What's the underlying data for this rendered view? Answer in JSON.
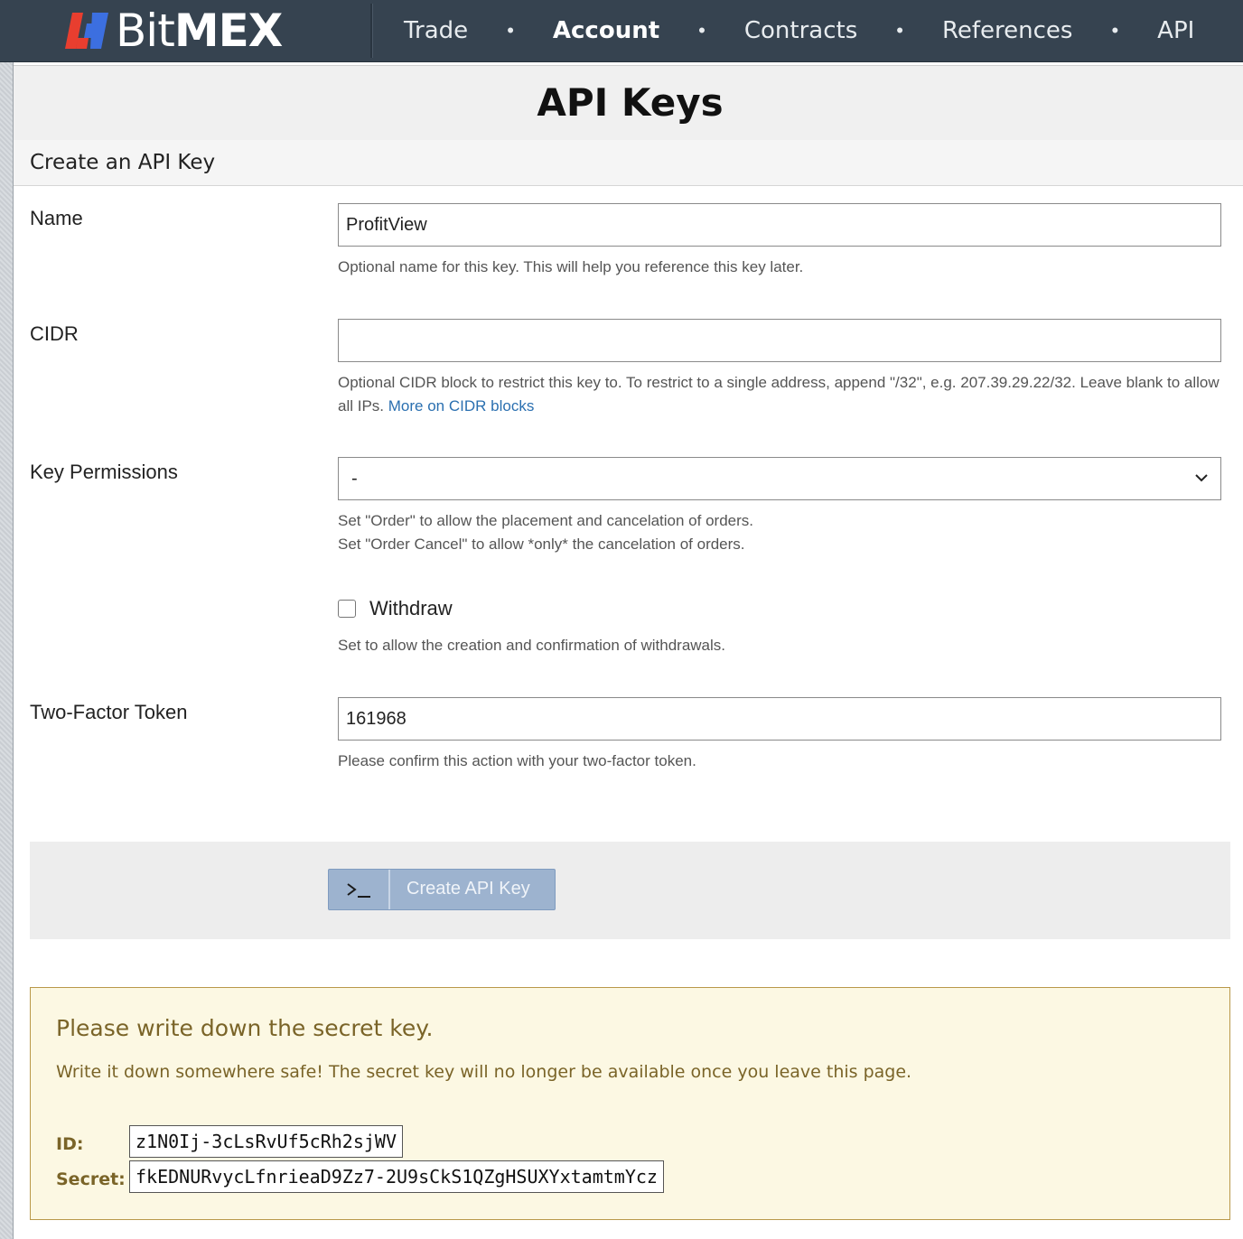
{
  "brand": {
    "logo_text_thin": "Bit",
    "logo_text_bold": "MEX",
    "colors": {
      "navbar": "#364350",
      "logo_red": "#e83e2f",
      "logo_blue": "#3c6fe0"
    }
  },
  "nav": {
    "items": [
      {
        "label": "Trade",
        "active": false
      },
      {
        "label": "Account",
        "active": true
      },
      {
        "label": "Contracts",
        "active": false
      },
      {
        "label": "References",
        "active": false
      },
      {
        "label": "API",
        "active": false
      }
    ],
    "separator": "•"
  },
  "page": {
    "title": "API Keys"
  },
  "form": {
    "section_title": "Create an API Key",
    "name": {
      "label": "Name",
      "value": "ProfitView",
      "help": "Optional name for this key. This will help you reference this key later."
    },
    "cidr": {
      "label": "CIDR",
      "value": "",
      "help": "Optional CIDR block to restrict this key to. To restrict to a single address, append \"/32\", e.g. 207.39.29.22/32. Leave blank to allow all IPs.",
      "help_link": "More on CIDR blocks"
    },
    "permissions": {
      "label": "Key Permissions",
      "selected": "-",
      "help_line1": "Set \"Order\" to allow the placement and cancelation of orders.",
      "help_line2": "Set \"Order Cancel\" to allow *only* the cancelation of orders."
    },
    "withdraw": {
      "label": "Withdraw",
      "checked": false,
      "help": "Set to allow the creation and confirmation of withdrawals."
    },
    "two_factor": {
      "label": "Two-Factor Token",
      "value": "161968",
      "help": "Please confirm this action with your two-factor token."
    },
    "submit": {
      "icon": ">_",
      "label": "Create API Key"
    }
  },
  "secret_notice": {
    "title": "Please write down the secret key.",
    "text": "Write it down somewhere safe! The secret key will no longer be available once you leave this page.",
    "id_label": "ID:",
    "id_value": "z1N0Ij-3cLsRvUf5cRh2sjWV",
    "secret_label": "Secret:",
    "secret_value": "fkEDNURvycLfnrieaD9Zz7-2U9sCkS1QZgHSUXYxtamtmYcz"
  }
}
